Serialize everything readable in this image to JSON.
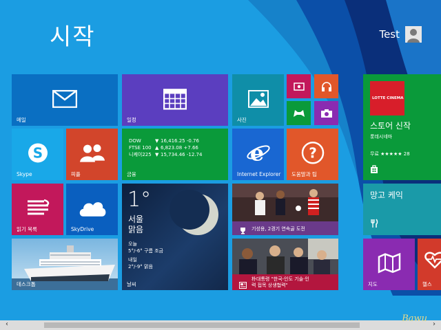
{
  "start": {
    "title": "시작"
  },
  "user": {
    "name": "Test"
  },
  "colors": {
    "background": "#1b9de2",
    "mail": "#0a6fc2",
    "calendar": "#5b3ebf",
    "photos": "#0f8ea8",
    "skype": "#19a8e8",
    "people": "#d2452b",
    "finance": "#0a9a3a",
    "ie": "#1967d2",
    "help": "#e1572a",
    "reading": "#c2185b",
    "skydrive": "#0a5fbf",
    "store": "#0a9a3a",
    "maps": "#8a2bb1",
    "health": "#d23a2b"
  },
  "tiles": {
    "mail": {
      "label": "메일",
      "icon": "mail-icon"
    },
    "calendar": {
      "label": "일정",
      "icon": "calendar-icon"
    },
    "photos": {
      "label": "사진",
      "icon": "photos-icon"
    },
    "video": {
      "icon": "video-icon"
    },
    "music": {
      "icon": "headphones-icon"
    },
    "games": {
      "icon": "gamepad-icon"
    },
    "camera": {
      "icon": "camera-icon"
    },
    "skype": {
      "label": "Skype",
      "icon": "skype-icon"
    },
    "people": {
      "label": "피플",
      "icon": "people-icon"
    },
    "finance": {
      "label": "금융",
      "rows": [
        {
          "name": "DOW",
          "dir": "▼",
          "value": "16,416.25 -0.76"
        },
        {
          "name": "FTSE 100",
          "dir": "▲",
          "value": "6,823.08 +7.66"
        },
        {
          "name": "니케이225",
          "dir": "▼",
          "value": "15,734.46 -12.74"
        }
      ]
    },
    "ie": {
      "label": "Internet Explorer",
      "icon": "ie-icon"
    },
    "help": {
      "label": "도움말과 팁",
      "icon": "help-icon"
    },
    "reading": {
      "label": "읽기 목록",
      "icon": "reading-list-icon"
    },
    "skydrive": {
      "label": "SkyDrive",
      "icon": "cloud-icon"
    },
    "weather": {
      "label": "날씨",
      "temp": "1°",
      "city": "서울",
      "condition": "맑음",
      "today_label": "오늘",
      "today": "5°/-6° 구름 조금",
      "tomorrow_label": "내일",
      "tomorrow": "2°/-9° 맑음"
    },
    "sports": {
      "caption": "기성용, 2경기 연속골 도전",
      "icon": "trophy-icon"
    },
    "news": {
      "caption_line1": "朴대통령 \"한국-인도 기술·인",
      "caption_line2": "력 접목 상생협력\"",
      "icon": "news-icon"
    },
    "desktop": {
      "label": "데스크톱"
    },
    "store": {
      "title": "스토어 신작",
      "app_name": "롯데시네마",
      "price": "무료",
      "stars": "★★★★★",
      "rating_count": "28",
      "app_logo_text": "LOTTE CINEMA",
      "icon": "store-bag-icon"
    },
    "mango": {
      "title": "망고 케익",
      "icon": "food-icon"
    },
    "maps": {
      "label": "지도",
      "icon": "map-icon"
    },
    "health": {
      "label": "헬스",
      "icon": "heart-icon"
    }
  },
  "watermark": "Bawu",
  "scroll": {
    "left_arrow": "‹",
    "right_arrow": "›"
  }
}
